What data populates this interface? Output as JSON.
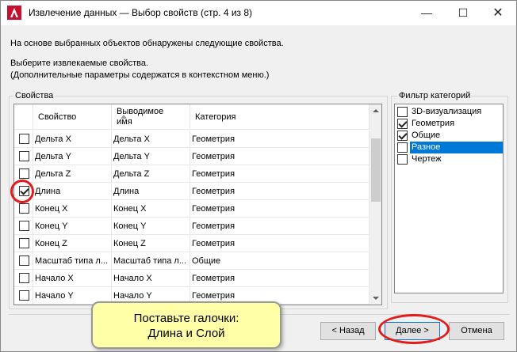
{
  "window": {
    "title": "Извлечение данных — Выбор свойств (стр. 4 из 8)",
    "min_glyph": "—",
    "max_glyph": "☐",
    "close_glyph": "✕"
  },
  "info": {
    "line1": "На основе выбранных объектов обнаружены следующие свойства.",
    "line2": "Выберите извлекаемые свойства.",
    "line3": "(Дополнительные параметры содержатся в контекстном меню.)"
  },
  "properties": {
    "group_label": "Свойства",
    "columns": [
      "Свойство",
      "Выводимое имя",
      "Категория"
    ],
    "rows": [
      {
        "checked": false,
        "name": "Дельта X",
        "display": "Дельта X",
        "category": "Геометрия"
      },
      {
        "checked": false,
        "name": "Дельта Y",
        "display": "Дельта Y",
        "category": "Геометрия"
      },
      {
        "checked": false,
        "name": "Дельта Z",
        "display": "Дельта Z",
        "category": "Геометрия"
      },
      {
        "checked": true,
        "name": "Длина",
        "display": "Длина",
        "category": "Геометрия"
      },
      {
        "checked": false,
        "name": "Конец X",
        "display": "Конец X",
        "category": "Геометрия"
      },
      {
        "checked": false,
        "name": "Конец Y",
        "display": "Конец Y",
        "category": "Геометрия"
      },
      {
        "checked": false,
        "name": "Конец Z",
        "display": "Конец Z",
        "category": "Геометрия"
      },
      {
        "checked": false,
        "name": "Масштаб типа л...",
        "display": "Масштаб типа л...",
        "category": "Общие"
      },
      {
        "checked": false,
        "name": "Начало X",
        "display": "Начало X",
        "category": "Геометрия"
      },
      {
        "checked": false,
        "name": "Начало Y",
        "display": "Начало Y",
        "category": "Геометрия"
      }
    ]
  },
  "filter": {
    "group_label": "Фильтр категорий",
    "items": [
      {
        "checked": false,
        "label": "3D-визуализация",
        "selected": false
      },
      {
        "checked": true,
        "label": "Геометрия",
        "selected": false
      },
      {
        "checked": true,
        "label": "Общие",
        "selected": false
      },
      {
        "checked": false,
        "label": "Разное",
        "selected": true
      },
      {
        "checked": false,
        "label": "Чертеж",
        "selected": false
      }
    ]
  },
  "buttons": {
    "back": "< Назад",
    "next": "Далее >",
    "cancel": "Отмена"
  },
  "tooltip": {
    "line1": "Поставьте галочки:",
    "line2": "Длина и Слой"
  },
  "colors": {
    "highlight_circle": "#e51b1b",
    "selection": "#0078d7",
    "tooltip_bg": "#ffffa8"
  }
}
